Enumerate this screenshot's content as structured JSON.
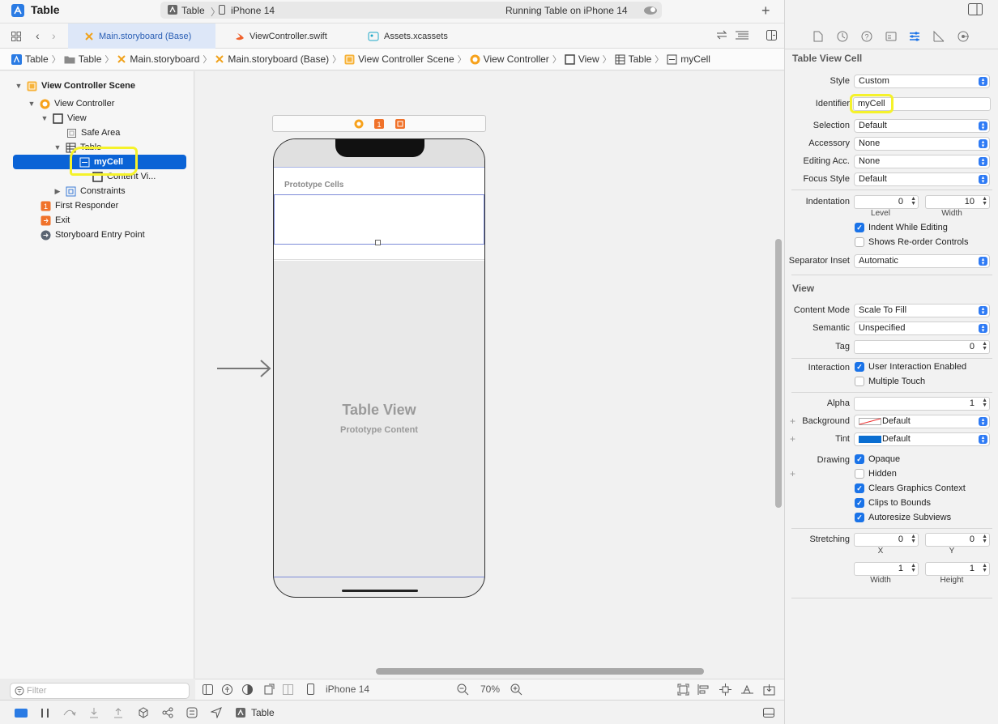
{
  "toolbar": {
    "app_title": "Table",
    "scheme_name": "Table",
    "device": "iPhone 14",
    "status": "Running Table on iPhone 14"
  },
  "tabs": [
    {
      "label": "Main.storyboard (Base)",
      "active": true
    },
    {
      "label": "ViewController.swift",
      "active": false
    },
    {
      "label": "Assets.xcassets",
      "active": false
    }
  ],
  "jumpbar": [
    "Table",
    "Table",
    "Main.storyboard",
    "Main.storyboard (Base)",
    "View Controller Scene",
    "View Controller",
    "View",
    "Table",
    "myCell"
  ],
  "outline": {
    "scene": "View Controller Scene",
    "view_controller": "View Controller",
    "view": "View",
    "safe_area": "Safe Area",
    "table": "Table",
    "cell": "myCell",
    "content_view": "Content Vi...",
    "constraints": "Constraints",
    "first_responder": "First Responder",
    "exit": "Exit",
    "entry_point": "Storyboard Entry Point"
  },
  "filter": {
    "placeholder": "Filter"
  },
  "canvas": {
    "prototype_cells": "Prototype Cells",
    "table_view_title": "Table View",
    "table_view_subtitle": "Prototype Content",
    "device": "iPhone 14",
    "zoom": "70%"
  },
  "debug": {
    "scheme": "Table"
  },
  "inspector": {
    "section_cell": "Table View Cell",
    "style_label": "Style",
    "style_value": "Custom",
    "identifier_label": "Identifier",
    "identifier_value": "myCell",
    "selection_label": "Selection",
    "selection_value": "Default",
    "accessory_label": "Accessory",
    "accessory_value": "None",
    "editing_acc_label": "Editing Acc.",
    "editing_acc_value": "None",
    "focus_label": "Focus Style",
    "focus_value": "Default",
    "indentation_label": "Indentation",
    "indent_level": "0",
    "indent_level_label": "Level",
    "indent_width": "10",
    "indent_width_label": "Width",
    "indent_while_editing": "Indent While Editing",
    "shows_reorder": "Shows Re-order Controls",
    "separator_label": "Separator Inset",
    "separator_value": "Automatic",
    "section_view": "View",
    "content_mode_label": "Content Mode",
    "content_mode_value": "Scale To Fill",
    "semantic_label": "Semantic",
    "semantic_value": "Unspecified",
    "tag_label": "Tag",
    "tag_value": "0",
    "interaction_label": "Interaction",
    "user_interaction": "User Interaction Enabled",
    "multiple_touch": "Multiple Touch",
    "alpha_label": "Alpha",
    "alpha_value": "1",
    "background_label": "Background",
    "background_value": "Default",
    "tint_label": "Tint",
    "tint_value": "Default",
    "drawing_label": "Drawing",
    "opaque": "Opaque",
    "hidden": "Hidden",
    "clears_context": "Clears Graphics Context",
    "clips_bounds": "Clips to Bounds",
    "autoresize": "Autoresize Subviews",
    "stretching_label": "Stretching",
    "stretch_x": "0",
    "stretch_x_label": "X",
    "stretch_y": "0",
    "stretch_y_label": "Y",
    "stretch_w": "1",
    "stretch_w_label": "Width",
    "stretch_h": "1",
    "stretch_h_label": "Height"
  },
  "colors": {
    "accent": "#0a63d6",
    "highlight": "#f5f22a",
    "tint": "#0a6ed1"
  }
}
